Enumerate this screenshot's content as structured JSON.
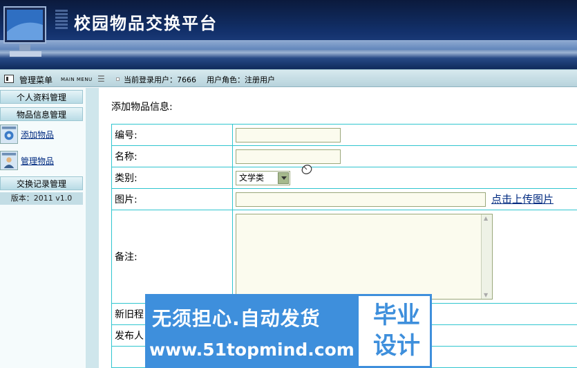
{
  "header": {
    "title": "校园物品交换平台"
  },
  "menubar": {
    "title": "管理菜单",
    "subtitle": "MAIN MENU",
    "separator": "☰",
    "current_user": "当前登录用户：7666",
    "user_role": "用户角色：注册用户"
  },
  "sidebar": {
    "items": [
      {
        "label": "个人资料管理"
      },
      {
        "label": "物品信息管理"
      },
      {
        "label": "添加物品",
        "icon": "gear-icon"
      },
      {
        "label": "管理物品",
        "icon": "user-icon"
      },
      {
        "label": "交换记录管理"
      }
    ],
    "version": "版本：2011 v1.0"
  },
  "form": {
    "title": "添加物品信息:",
    "fields": {
      "code_label": "编号:",
      "name_label": "名称:",
      "category_label": "类别:",
      "category_value": "文学类",
      "image_label": "图片:",
      "upload_link": "点击上传图片",
      "remark_label": "备注:",
      "condition_label": "新旧程",
      "publisher_label": "发布人"
    }
  },
  "watermark": {
    "slogan": "无须担心.自动发货",
    "url": "www.51topmind.com",
    "badge_line1": "毕业",
    "badge_line2": "设计"
  },
  "colors": {
    "accent": "#3e8fdc",
    "table_border": "#2fc5cf",
    "banner": "#12306a"
  }
}
